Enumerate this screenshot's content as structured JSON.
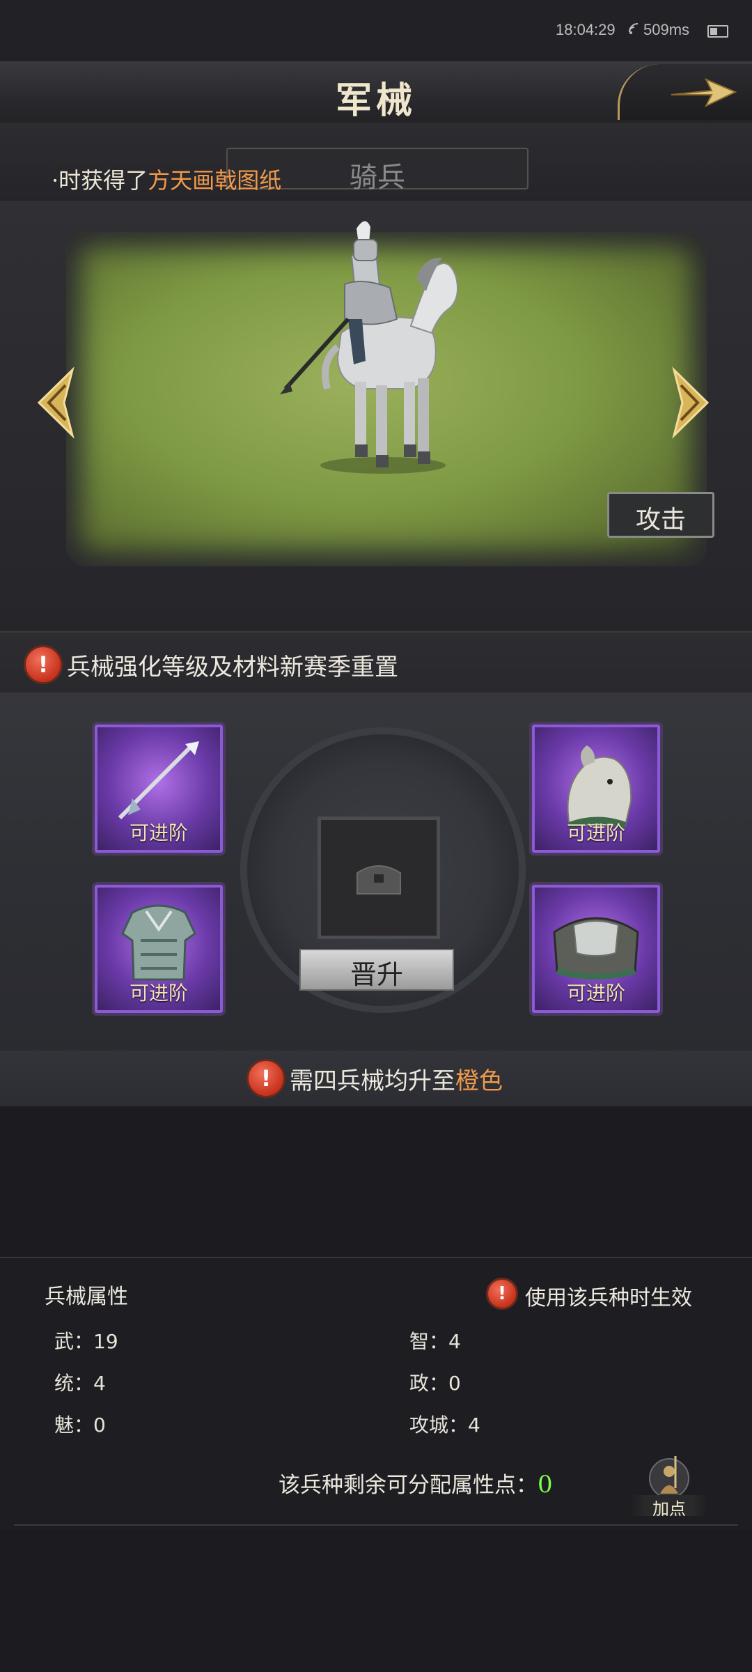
{
  "status_bar": {
    "time": "18:04:29",
    "latency": "509ms"
  },
  "header": {
    "title": "军械"
  },
  "troop": {
    "name": "骑兵",
    "marquee_prefix": "·时获得了",
    "marquee_item": "方天画戟图纸"
  },
  "scene": {
    "attack_label": "攻击"
  },
  "notices": {
    "reset": "兵械强化等级及材料新赛季重置",
    "upgrade_prefix": "需四兵械均升至",
    "upgrade_color": "橙色"
  },
  "equipment": {
    "slots": [
      {
        "name": "weapon",
        "label": "可进阶"
      },
      {
        "name": "horse",
        "label": "可进阶"
      },
      {
        "name": "armor",
        "label": "可进阶"
      },
      {
        "name": "saddle",
        "label": "可进阶"
      }
    ],
    "promote_label": "晋升"
  },
  "attributes": {
    "title": "兵械属性",
    "effect_note": "使用该兵种时生效",
    "left": [
      {
        "label": "武：",
        "value": "19"
      },
      {
        "label": "统：",
        "value": "4"
      },
      {
        "label": "魅：",
        "value": "0"
      }
    ],
    "right": [
      {
        "label": "智：",
        "value": "4"
      },
      {
        "label": "政：",
        "value": "0"
      },
      {
        "label": "攻城：",
        "value": "4"
      }
    ],
    "remaining_label": "该兵种剩余可分配属性点：",
    "remaining_value": "0",
    "add_point_label": "加点"
  },
  "colors": {
    "highlight": "#f09a4c",
    "remaining": "#7dff4a",
    "slot_purple": "#8b5ad6"
  }
}
